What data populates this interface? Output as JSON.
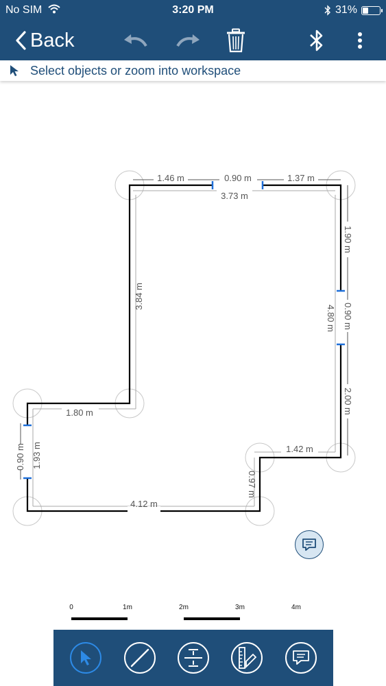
{
  "status_bar": {
    "carrier": "No SIM",
    "time": "3:20 PM",
    "battery_percent": "31%",
    "battery_level": 0.31,
    "wifi_icon": "wifi-icon",
    "bluetooth_icon": "bluetooth-small-icon"
  },
  "nav": {
    "back_label": "Back",
    "icons": [
      "undo-icon",
      "redo-icon",
      "trash-icon",
      "bluetooth-icon",
      "more-vertical-icon"
    ]
  },
  "hint": {
    "text": "Select objects or zoom into workspace",
    "icon": "pointer-icon"
  },
  "floorplan": {
    "dimensions": {
      "top_left_segment": "1.46 m",
      "top_opening": "0.90 m",
      "top_right_segment": "1.37 m",
      "top_total": "3.73 m",
      "left_upper_wall": "3.84 m",
      "right_upper_segment": "1.90 m",
      "right_opening": "0.90 m",
      "right_total": "4.80 m",
      "right_lower_segment": "2.00 m",
      "middle_step": "1.80 m",
      "left_opening": "0.90 m",
      "left_lower_wall": "1.93 m",
      "bottom_wall": "4.12 m",
      "inner_vertical": "0.97 m",
      "inner_step": "1.42 m"
    }
  },
  "scale_bar": {
    "labels": [
      "0",
      "1m",
      "2m",
      "3m",
      "4m"
    ]
  },
  "toolbar": {
    "tools": [
      "select-tool",
      "wall-tool",
      "measure-tool",
      "ruler-tool",
      "note-tool"
    ],
    "active": "select-tool"
  },
  "colors": {
    "primary": "#1f4e79",
    "accent": "#2d8ae6",
    "wall": "#000000",
    "dimension": "#a0a0a0",
    "marker": "#1e6fd9"
  }
}
